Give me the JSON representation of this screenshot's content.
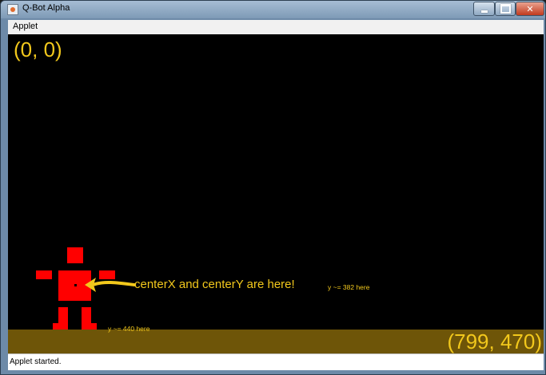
{
  "window": {
    "title": "Q-Bot Alpha"
  },
  "menubar": {
    "items": [
      "Applet"
    ]
  },
  "canvas": {
    "origin_label": "(0, 0)",
    "corner_label": "(799, 470)",
    "annotation_center": "centerX and centerY are here!",
    "annotation_y382": "y ~= 382 here",
    "annotation_y440": "y ~= 440 here",
    "robot_color": "#ff0000",
    "floor_color": "#6e5508",
    "background_color": "#000000",
    "text_color": "#f2c81c"
  },
  "status": {
    "text": "Applet started."
  },
  "icons": [
    "java-app-icon",
    "minimize-icon",
    "maximize-icon",
    "close-icon",
    "arrow-icon"
  ]
}
